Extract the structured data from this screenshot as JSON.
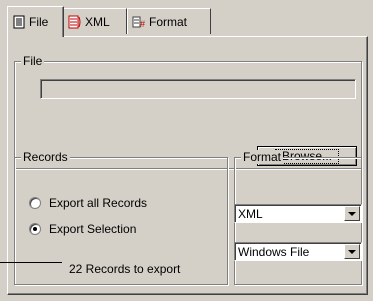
{
  "tabs": [
    {
      "label": "File",
      "icon": "document-icon"
    },
    {
      "label": "XML",
      "icon": "xml-icon"
    },
    {
      "label": "Format",
      "icon": "format-icon"
    }
  ],
  "file_group": {
    "title": "File",
    "path_value": "",
    "browse_label": "Browse..."
  },
  "records_group": {
    "title": "Records",
    "options": [
      {
        "label": "Export all Records",
        "selected": false
      },
      {
        "label": "Export Selection",
        "selected": true
      }
    ],
    "count_text": "22 Records to export"
  },
  "format_group": {
    "title": "Format",
    "format_select": {
      "value": "XML"
    },
    "line_ending_select": {
      "value": "Windows File"
    }
  }
}
